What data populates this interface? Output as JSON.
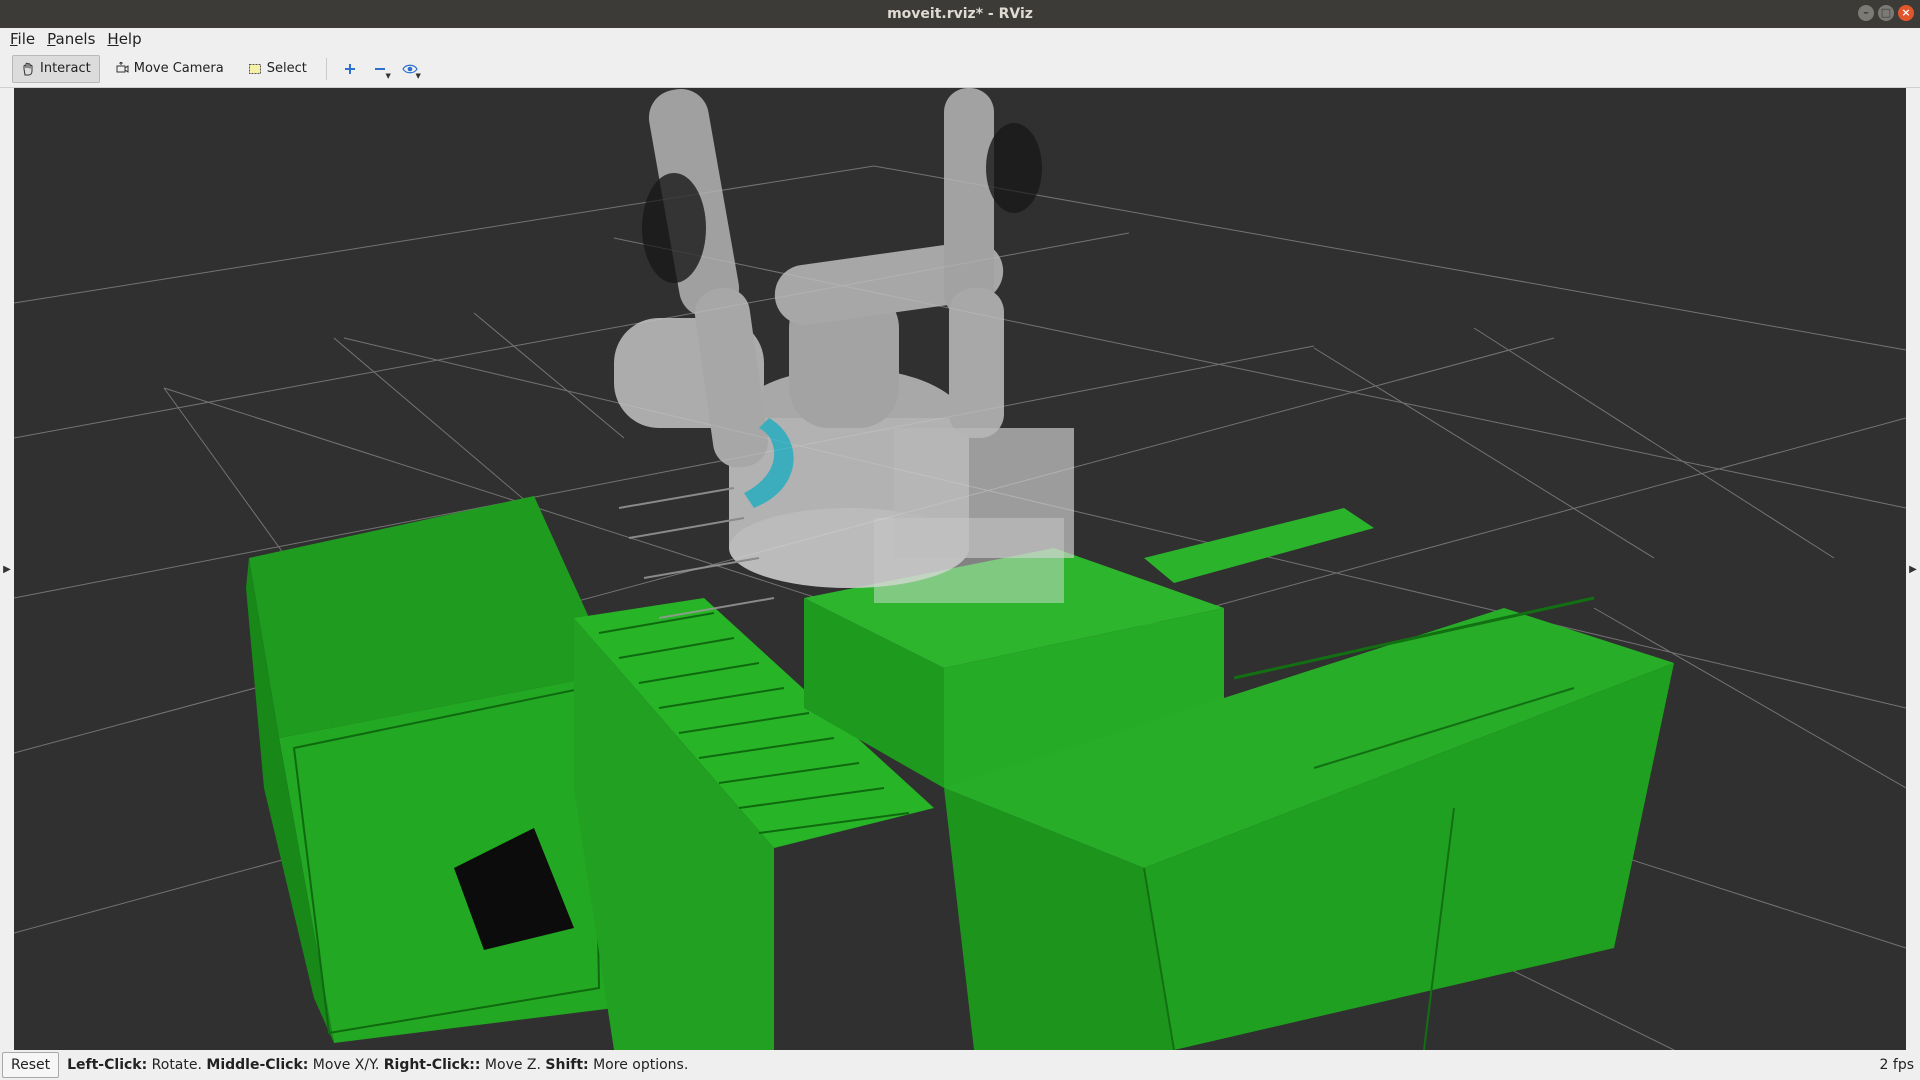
{
  "window": {
    "title": "moveit.rviz* - RViz"
  },
  "menu": {
    "file": {
      "mnemonic": "F",
      "rest": "ile"
    },
    "panels": {
      "mnemonic": "P",
      "rest": "anels"
    },
    "help": {
      "mnemonic": "H",
      "rest": "elp"
    }
  },
  "toolbar": {
    "interact": "Interact",
    "move_camera": "Move Camera",
    "select": "Select",
    "add_tool_icon": "plus-icon",
    "remove_tool_icon": "minus-icon",
    "view_icon": "eye-icon"
  },
  "viewport": {
    "background_color": "#303030",
    "grid_color": "#8a8a8a",
    "scene_color": "#24a824",
    "robot_color": "#c8c8c8",
    "highlight_color": "#3fc3d6"
  },
  "status": {
    "reset": "Reset",
    "hint": [
      {
        "key": "Left-Click:",
        "action": " Rotate. "
      },
      {
        "key": "Middle-Click:",
        "action": " Move X/Y. "
      },
      {
        "key": "Right-Click::",
        "action": " Move Z. "
      },
      {
        "key": "Shift:",
        "action": " More options."
      }
    ],
    "fps": "2 fps"
  }
}
